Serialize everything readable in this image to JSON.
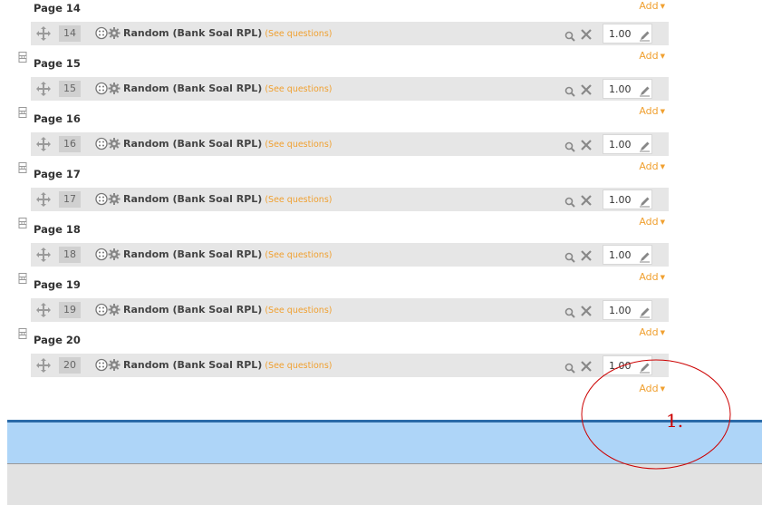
{
  "pages": [
    {
      "label": "Page 14",
      "slot": {
        "number": "14",
        "title": "Random (Bank Soal RPL)",
        "see_questions": "(See questions)",
        "mark": "1.00"
      }
    },
    {
      "label": "Page 15",
      "slot": {
        "number": "15",
        "title": "Random (Bank Soal RPL)",
        "see_questions": "(See questions)",
        "mark": "1.00"
      }
    },
    {
      "label": "Page 16",
      "slot": {
        "number": "16",
        "title": "Random (Bank Soal RPL)",
        "see_questions": "(See questions)",
        "mark": "1.00"
      }
    },
    {
      "label": "Page 17",
      "slot": {
        "number": "17",
        "title": "Random (Bank Soal RPL)",
        "see_questions": "(See questions)",
        "mark": "1.00"
      }
    },
    {
      "label": "Page 18",
      "slot": {
        "number": "18",
        "title": "Random (Bank Soal RPL)",
        "see_questions": "(See questions)",
        "mark": "1.00"
      }
    },
    {
      "label": "Page 19",
      "slot": {
        "number": "19",
        "title": "Random (Bank Soal RPL)",
        "see_questions": "(See questions)",
        "mark": "1.00"
      }
    },
    {
      "label": "Page 20",
      "slot": {
        "number": "20",
        "title": "Random (Bank Soal RPL)",
        "see_questions": "(See questions)",
        "mark": "1.00"
      }
    }
  ],
  "add_label": "Add",
  "annotation": {
    "label": "1.",
    "color": "#cc0000"
  },
  "colors": {
    "accent": "#f0a030",
    "slot_bg": "#e6e6e6",
    "blue_bar": "#aed5f8",
    "blue_border": "#2a6aa8"
  },
  "icons": {
    "move": "move-arrows-icon",
    "random": "dice-gear-icon",
    "preview": "magnifier-icon",
    "delete": "close-icon",
    "edit": "pencil-icon",
    "page_break": "page-break-icon",
    "dropdown": "caret-down-icon"
  }
}
